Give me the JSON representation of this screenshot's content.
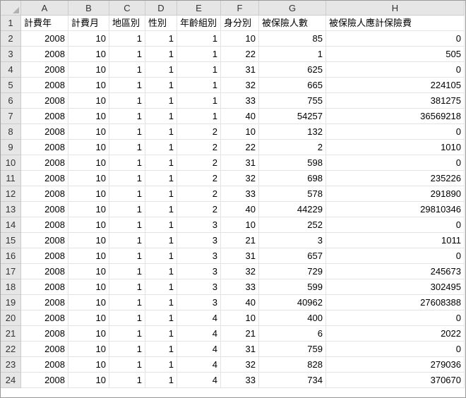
{
  "columns": [
    "A",
    "B",
    "C",
    "D",
    "E",
    "F",
    "G",
    "H"
  ],
  "row_numbers": [
    1,
    2,
    3,
    4,
    5,
    6,
    7,
    8,
    9,
    10,
    11,
    12,
    13,
    14,
    15,
    16,
    17,
    18,
    19,
    20,
    21,
    22,
    23,
    24
  ],
  "chart_data": {
    "type": "table",
    "headers": [
      "計費年",
      "計費月",
      "地區別",
      "性別",
      "年齡組別",
      "身分別",
      "被保險人數",
      "被保險人應計保險費"
    ],
    "rows": [
      [
        2008,
        10,
        1,
        1,
        1,
        10,
        85,
        0
      ],
      [
        2008,
        10,
        1,
        1,
        1,
        22,
        1,
        505
      ],
      [
        2008,
        10,
        1,
        1,
        1,
        31,
        625,
        0
      ],
      [
        2008,
        10,
        1,
        1,
        1,
        32,
        665,
        224105
      ],
      [
        2008,
        10,
        1,
        1,
        1,
        33,
        755,
        381275
      ],
      [
        2008,
        10,
        1,
        1,
        1,
        40,
        54257,
        36569218
      ],
      [
        2008,
        10,
        1,
        1,
        2,
        10,
        132,
        0
      ],
      [
        2008,
        10,
        1,
        1,
        2,
        22,
        2,
        1010
      ],
      [
        2008,
        10,
        1,
        1,
        2,
        31,
        598,
        0
      ],
      [
        2008,
        10,
        1,
        1,
        2,
        32,
        698,
        235226
      ],
      [
        2008,
        10,
        1,
        1,
        2,
        33,
        578,
        291890
      ],
      [
        2008,
        10,
        1,
        1,
        2,
        40,
        44229,
        29810346
      ],
      [
        2008,
        10,
        1,
        1,
        3,
        10,
        252,
        0
      ],
      [
        2008,
        10,
        1,
        1,
        3,
        21,
        3,
        1011
      ],
      [
        2008,
        10,
        1,
        1,
        3,
        31,
        657,
        0
      ],
      [
        2008,
        10,
        1,
        1,
        3,
        32,
        729,
        245673
      ],
      [
        2008,
        10,
        1,
        1,
        3,
        33,
        599,
        302495
      ],
      [
        2008,
        10,
        1,
        1,
        3,
        40,
        40962,
        27608388
      ],
      [
        2008,
        10,
        1,
        1,
        4,
        10,
        400,
        0
      ],
      [
        2008,
        10,
        1,
        1,
        4,
        21,
        6,
        2022
      ],
      [
        2008,
        10,
        1,
        1,
        4,
        31,
        759,
        0
      ],
      [
        2008,
        10,
        1,
        1,
        4,
        32,
        828,
        279036
      ],
      [
        2008,
        10,
        1,
        1,
        4,
        33,
        734,
        370670
      ]
    ]
  }
}
